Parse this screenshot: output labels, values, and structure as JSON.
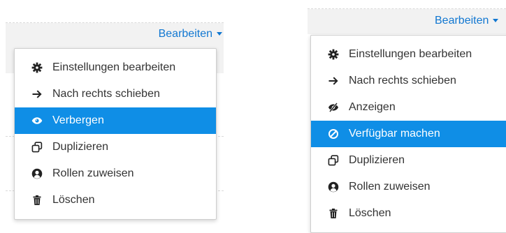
{
  "left": {
    "edit_label": "Bearbeiten",
    "items": [
      {
        "label": "Einstellungen bearbeiten",
        "icon": "cog-icon",
        "active": false
      },
      {
        "label": "Nach rechts schieben",
        "icon": "arrow-right-icon",
        "active": false
      },
      {
        "label": "Verbergen",
        "icon": "eye-icon",
        "active": true
      },
      {
        "label": "Duplizieren",
        "icon": "copy-icon",
        "active": false
      },
      {
        "label": "Rollen zuweisen",
        "icon": "user-icon",
        "active": false
      },
      {
        "label": "Löschen",
        "icon": "trash-icon",
        "active": false
      }
    ]
  },
  "right": {
    "edit_label": "Bearbeiten",
    "items": [
      {
        "label": "Einstellungen bearbeiten",
        "icon": "cog-icon",
        "active": false
      },
      {
        "label": "Nach rechts schieben",
        "icon": "arrow-right-icon",
        "active": false
      },
      {
        "label": "Anzeigen",
        "icon": "eye-slash-icon",
        "active": false
      },
      {
        "label": "Verfügbar machen",
        "icon": "ban-icon",
        "active": true
      },
      {
        "label": "Duplizieren",
        "icon": "copy-icon",
        "active": false
      },
      {
        "label": "Rollen zuweisen",
        "icon": "user-icon",
        "active": false
      },
      {
        "label": "Löschen",
        "icon": "trash-icon",
        "active": false
      }
    ]
  },
  "colors": {
    "accent": "#1177d1",
    "highlight": "#0f8ee6"
  }
}
